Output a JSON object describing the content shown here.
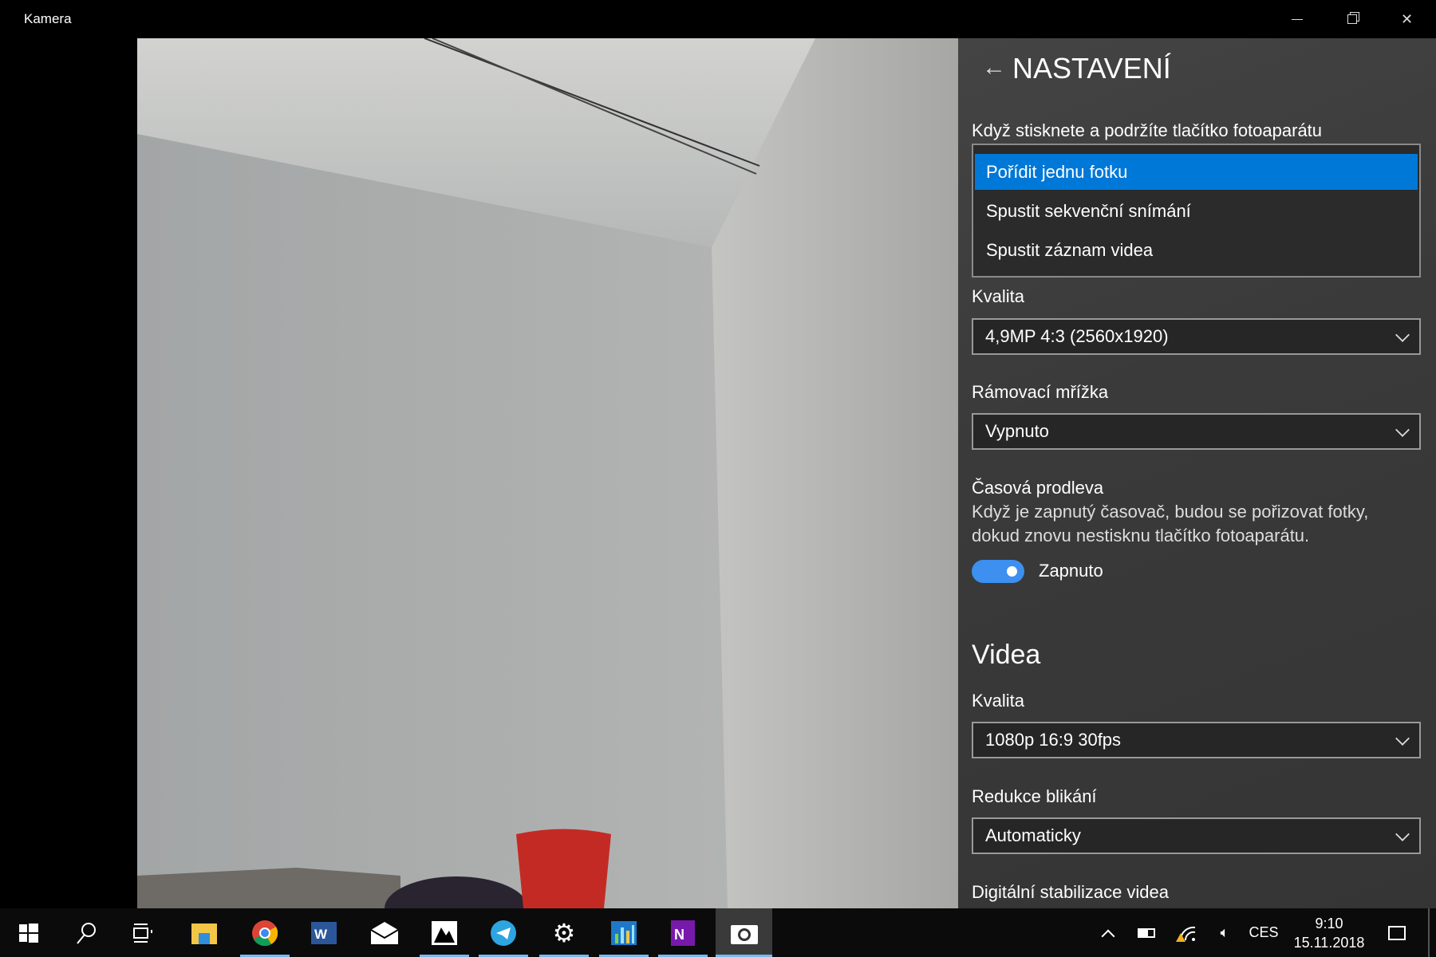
{
  "window": {
    "title": "Kamera",
    "minimize_icon": "minimize-icon",
    "restore_icon": "restore-icon",
    "close_icon": "close-icon"
  },
  "settings": {
    "title": "NASTAVENÍ",
    "hold_label": "Když stisknete a podržíte tlačítko fotoaparátu",
    "hold_options": [
      "Pořídit jednu fotku",
      "Spustit sekvenční snímání",
      "Spustit záznam videa"
    ],
    "hold_selected_index": 0,
    "photo_quality_label": "Kvalita",
    "photo_quality_value": "4,9MP 4:3 (2560x1920)",
    "grid_label": "Rámovací mřížka",
    "grid_value": "Vypnuto",
    "timelapse_label": "Časová prodleva",
    "timelapse_desc_1": "Když je zapnutý časovač, budou se pořizovat fotky,",
    "timelapse_desc_2": "dokud znovu nestisknu tlačítko fotoaparátu.",
    "timelapse_toggle_on": true,
    "timelapse_toggle_label": "Zapnuto",
    "videos_heading": "Videa",
    "video_quality_label": "Kvalita",
    "video_quality_value": "1080p 16:9 30fps",
    "flicker_label": "Redukce blikání",
    "flicker_value": "Automaticky",
    "stabilization_label": "Digitální stabilizace videa"
  },
  "colors": {
    "accent": "#0078d7",
    "toggle": "#3d8ff0",
    "taskbar": "#0b0b0b"
  },
  "taskbar": {
    "apps": [
      "start",
      "search",
      "task-view",
      "file-explorer",
      "chrome",
      "word",
      "mail",
      "photos",
      "telegram",
      "settings",
      "chart-app",
      "onenote",
      "camera"
    ],
    "tray": {
      "language": "CES",
      "time": "9:10",
      "date": "15.11.2018"
    }
  }
}
